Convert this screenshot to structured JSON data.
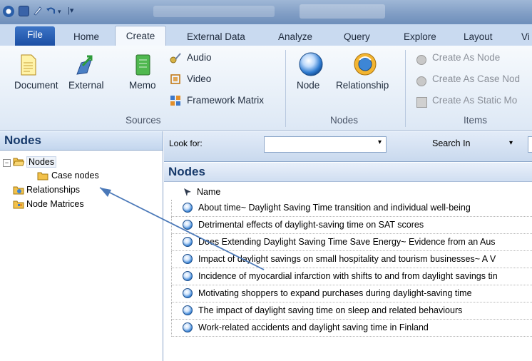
{
  "ribbon": {
    "tabs": [
      "File",
      "Home",
      "Create",
      "External Data",
      "Analyze",
      "Query",
      "Explore",
      "Layout",
      "Vi"
    ],
    "active_tab": "Create",
    "sources": {
      "document": "Document",
      "external": "External",
      "memo": "Memo",
      "audio": "Audio",
      "video": "Video",
      "framework_matrix": "Framework Matrix",
      "label": "Sources"
    },
    "nodes_group": {
      "node": "Node",
      "relationship": "Relationship",
      "label": "Nodes"
    },
    "items_group": {
      "create_as_node": "Create As Node",
      "create_as_case_node": "Create As Case Nod",
      "create_as_static": "Create As Static Mo",
      "label": "Items"
    }
  },
  "nav": {
    "title": "Nodes",
    "tree": {
      "nodes": "Nodes",
      "case_nodes": "Case nodes",
      "relationships": "Relationships",
      "node_matrices": "Node Matrices"
    }
  },
  "main": {
    "look_for": "Look for:",
    "search_in": "Search In",
    "title": "Nodes",
    "column_name": "Name",
    "rows": [
      "About time~ Daylight Saving Time transition and individual well-being",
      "Detrimental effects of daylight-saving time on SAT scores",
      "Does Extending Daylight Saving Time Save Energy~ Evidence from an Aus",
      "Impact of daylight savings on small hospitality and tourism businesses~ A V",
      "Incidence of myocardial infarction with shifts to and from daylight savings tin",
      "Motivating shoppers to expand purchases during daylight-saving time",
      "The impact of daylight saving time on sleep and related behaviours",
      "Work-related accidents and daylight saving time in Finland"
    ]
  },
  "colors": {
    "title_blue": "#173a6b",
    "node_icon": "#3d86d6",
    "annotation_arrow": "#4a78b8"
  }
}
